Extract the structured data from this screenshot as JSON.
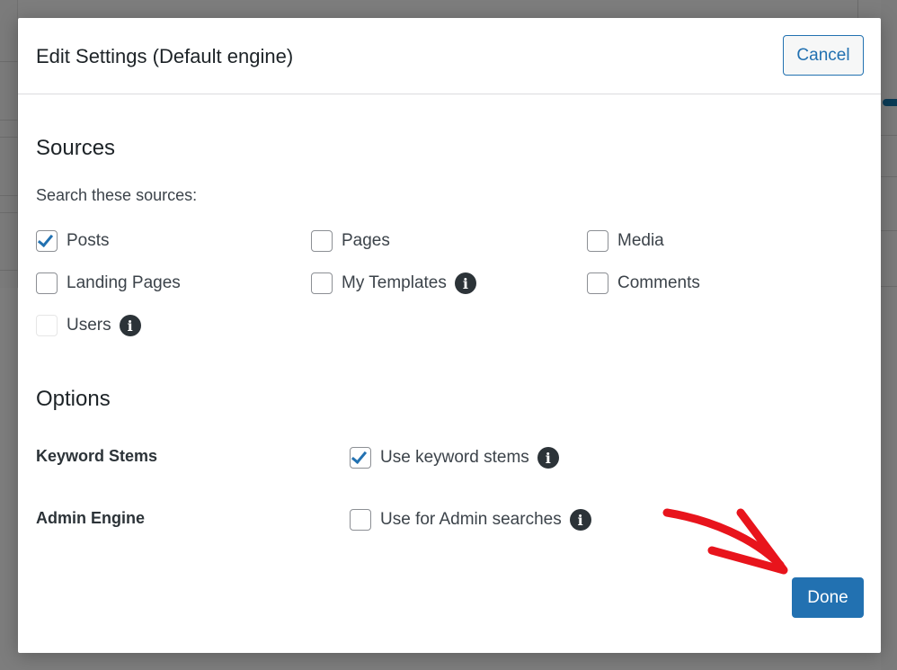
{
  "modal": {
    "title": "Edit Settings (Default engine)",
    "cancel_label": "Cancel",
    "done_label": "Done"
  },
  "sources": {
    "heading": "Sources",
    "hint": "Search these sources:",
    "items": [
      {
        "label": "Posts",
        "checked": true,
        "info": false
      },
      {
        "label": "Pages",
        "checked": false,
        "info": false
      },
      {
        "label": "Media",
        "checked": false,
        "info": false
      },
      {
        "label": "Landing Pages",
        "checked": false,
        "info": false
      },
      {
        "label": "My Templates",
        "checked": false,
        "info": true
      },
      {
        "label": "Comments",
        "checked": false,
        "info": false
      },
      {
        "label": "Users",
        "checked": false,
        "info": true,
        "disabled": true
      }
    ]
  },
  "options": {
    "heading": "Options",
    "keyword_stems": {
      "label": "Keyword Stems",
      "checkbox_label": "Use keyword stems",
      "checked": true
    },
    "admin_engine": {
      "label": "Admin Engine",
      "checkbox_label": "Use for Admin searches",
      "checked": false
    }
  },
  "info_glyph": "i",
  "colors": {
    "accent": "#2271b1",
    "arrow": "#e8141c"
  }
}
